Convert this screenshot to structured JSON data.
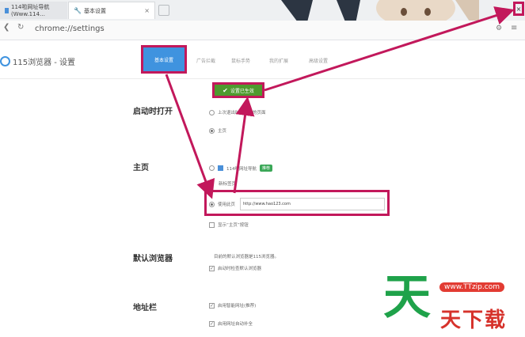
{
  "browser": {
    "tabs": [
      {
        "label": "114啦网址导航(Www.114…"
      },
      {
        "label": "基本设置"
      }
    ],
    "address": "chrome://settings"
  },
  "app": {
    "title": "115浏览器 - 设置"
  },
  "nav_tabs": [
    "基本设置",
    "广告拦截",
    "鼠标手势",
    "我的扩展",
    "高级设置",
    "…"
  ],
  "save_button": {
    "label": "设置已生效"
  },
  "sections": {
    "startup": {
      "title": "启动时打开",
      "options": [
        "上次退出时未关闭的页面",
        "主页"
      ]
    },
    "homepage": {
      "title": "主页",
      "options": [
        "114啦网址导航",
        "新标签页",
        "使用此页"
      ],
      "badge": "推荐",
      "url_value": "http://www.hao123.com",
      "show_button": "显示“主页”按钮"
    },
    "default_browser": {
      "title": "默认浏览器",
      "desc": "目前的默认浏览器是115浏览器。",
      "check": "启动时检查默认浏览器"
    },
    "addressbar": {
      "title": "地址栏",
      "checks": [
        "启用智能网址(推荐)",
        "启用网址自动补全"
      ]
    }
  },
  "watermark": {
    "url": "www.TTzip.com",
    "bigchar": "天",
    "text": "天下载"
  },
  "colors": {
    "highlight": "#c2185b",
    "active_tab": "#3f93df",
    "save": "#4e9a2e"
  }
}
